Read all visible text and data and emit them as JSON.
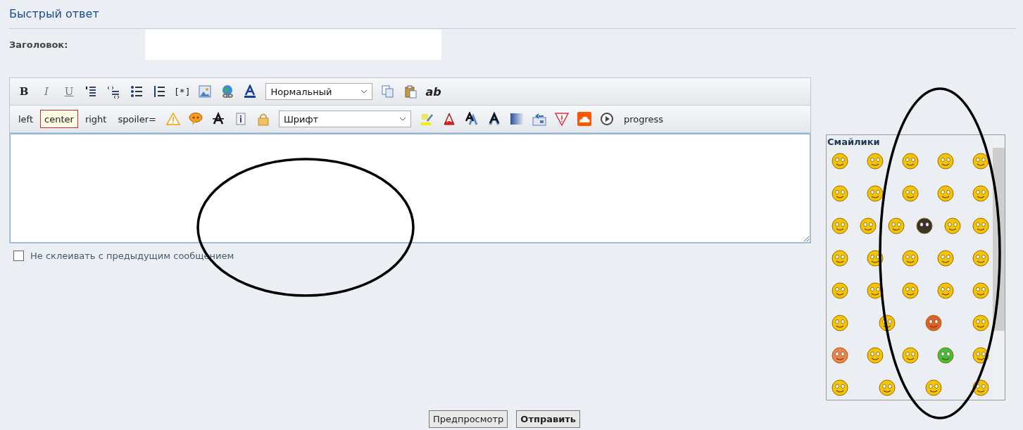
{
  "header": {
    "title": "Быстрый ответ"
  },
  "subject": {
    "label": "Заголовок:"
  },
  "toolbar_rows": [
    [
      {
        "kind": "glyph",
        "label": "B"
      },
      {
        "kind": "glyph",
        "label": "I"
      },
      {
        "kind": "glyph",
        "label": "U"
      },
      {
        "kind": "icon"
      },
      {
        "kind": "icon"
      },
      {
        "kind": "icon"
      },
      {
        "kind": "icon"
      },
      {
        "kind": "glyph",
        "label": "[*]"
      },
      {
        "kind": "icon"
      },
      {
        "kind": "icon"
      },
      {
        "kind": "icon"
      },
      {
        "kind": "select",
        "value": "Нормальный"
      },
      {
        "kind": "icon"
      },
      {
        "kind": "icon"
      },
      {
        "kind": "glyph",
        "label": "ab"
      }
    ],
    [
      {
        "kind": "text",
        "label": "left",
        "selected": false
      },
      {
        "kind": "text",
        "label": "center",
        "selected": true
      },
      {
        "kind": "text",
        "label": "right",
        "selected": false
      },
      {
        "kind": "text",
        "label": "spoiler=",
        "selected": false
      },
      {
        "kind": "icon"
      },
      {
        "kind": "icon"
      },
      {
        "kind": "icon"
      },
      {
        "kind": "icon"
      },
      {
        "kind": "icon"
      },
      {
        "kind": "select",
        "value": "Шрифт"
      },
      {
        "kind": "icon"
      },
      {
        "kind": "icon"
      },
      {
        "kind": "icon"
      },
      {
        "kind": "icon"
      },
      {
        "kind": "icon"
      },
      {
        "kind": "icon"
      },
      {
        "kind": "icon"
      },
      {
        "kind": "icon"
      },
      {
        "kind": "icon"
      },
      {
        "kind": "text",
        "label": "progress",
        "selected": false
      }
    ]
  ],
  "no_merge": {
    "label": "Не склеивать с предыдущим сообщением",
    "checked": false
  },
  "smilies": {
    "title": "Смайлики"
  },
  "buttons": [
    {
      "label": "Предпросмотр",
      "kind": "secondary"
    },
    {
      "label": "Отправить",
      "kind": "primary"
    }
  ]
}
